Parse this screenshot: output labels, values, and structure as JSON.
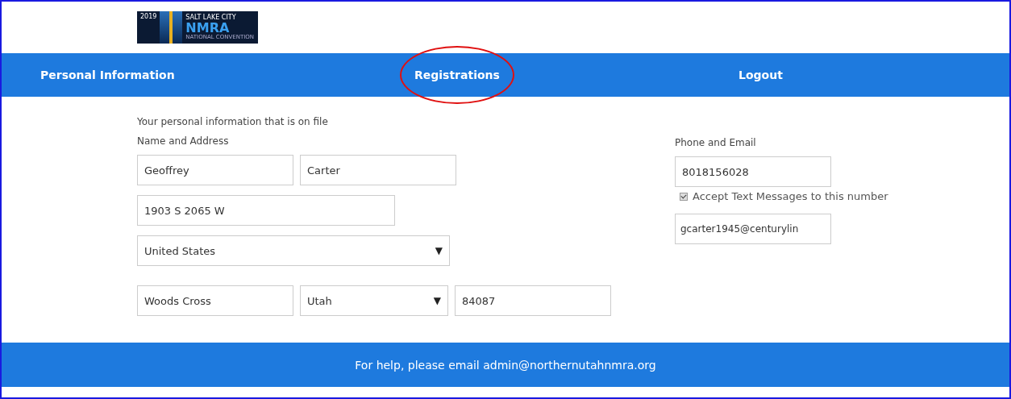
{
  "logo": {
    "year": "2019",
    "city": "SALT LAKE CITY",
    "name": "NMRA",
    "subtitle": "NATIONAL CONVENTION"
  },
  "nav": [
    {
      "label": "Personal Information",
      "circled": false
    },
    {
      "label": "Registrations",
      "circled": true
    },
    {
      "label": "Logout",
      "circled": false
    }
  ],
  "intro": "Your personal information that is on file",
  "name_address": {
    "heading": "Name and Address",
    "rows": [
      [
        {
          "kind": "text",
          "value": "Geoffrey"
        },
        {
          "kind": "text",
          "value": "Carter"
        }
      ],
      [
        {
          "kind": "text",
          "value": "1903 S 2065 W"
        }
      ],
      [
        {
          "kind": "select",
          "value": "United States",
          "caret": "▼"
        }
      ],
      [
        {
          "kind": "text",
          "value": "Woods Cross"
        },
        {
          "kind": "select",
          "value": "Utah",
          "caret": "▼"
        },
        {
          "kind": "text",
          "value": "84087"
        }
      ]
    ]
  },
  "phone_email": {
    "heading": "Phone and Email",
    "phone": "8018156028",
    "accept_texts": {
      "label": "Accept Text Messages to this number",
      "checked": true
    },
    "email": "gcarter1945@centurylin"
  },
  "footer": "For help, please email admin@northernutahnmra.org"
}
